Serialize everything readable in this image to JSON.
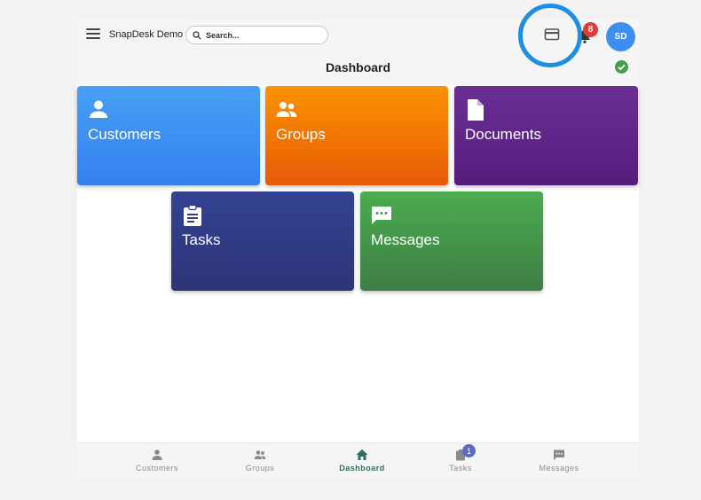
{
  "header": {
    "app_name": "SnapDesk Demo",
    "search_placeholder": "Search...",
    "notification_count": "8",
    "avatar_initials": "SD"
  },
  "page": {
    "title": "Dashboard"
  },
  "tiles": [
    {
      "label": "Customers",
      "icon": "person-icon"
    },
    {
      "label": "Groups",
      "icon": "group-icon"
    },
    {
      "label": "Documents",
      "icon": "document-icon"
    },
    {
      "label": "Tasks",
      "icon": "clipboard-icon"
    },
    {
      "label": "Messages",
      "icon": "chat-icon"
    }
  ],
  "bottom_nav": [
    {
      "label": "Customers",
      "icon": "person-icon"
    },
    {
      "label": "Groups",
      "icon": "group-icon"
    },
    {
      "label": "Dashboard",
      "icon": "home-icon",
      "active": true
    },
    {
      "label": "Tasks",
      "icon": "clipboard-icon",
      "badge": "1"
    },
    {
      "label": "Messages",
      "icon": "chat-icon"
    }
  ],
  "colors": {
    "accent": "#1e8fe0",
    "customers": "#3e8ef1",
    "groups": "#f57c00",
    "documents": "#5e2588",
    "tasks": "#313c86",
    "messages": "#45964c",
    "active_nav": "#2b6f64",
    "badge": "#e53935"
  }
}
